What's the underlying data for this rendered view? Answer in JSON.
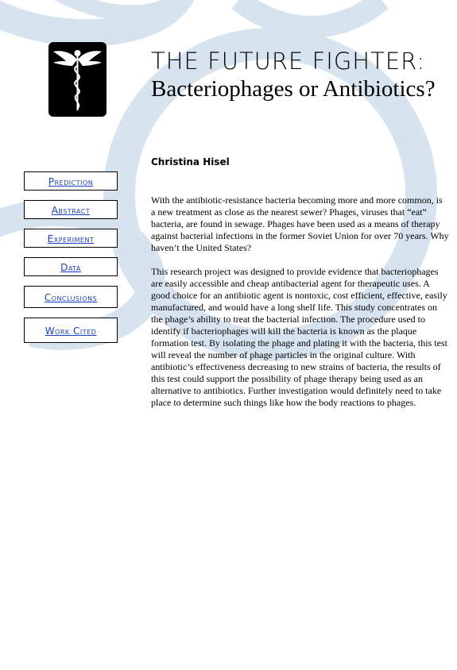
{
  "header": {
    "title_line1": "THE FUTURE FIGHTER:",
    "title_line2": "Bacteriophages or Antibiotics?",
    "logo_icon": "caduceus-icon"
  },
  "author": "Christina Hisel",
  "nav": {
    "items": [
      {
        "label": "Prediction"
      },
      {
        "label": "Abstract"
      },
      {
        "label": "Experiment"
      },
      {
        "label": "Data"
      },
      {
        "label": "Conclusions"
      },
      {
        "label": "Work Cited"
      }
    ]
  },
  "body": {
    "paragraph1": "With the antibiotic-resistance bacteria becoming more and more common, is a new treatment as close as the nearest sewer? Phages, viruses that “eat” bacteria, are found in sewage. Phages have been used as a means of therapy against bacterial infections in the former Soviet Union for over 70 years. Why haven’t the United States?",
    "paragraph2": "This research project was designed to provide evidence that bacteriophages are easily accessible and cheap antibacterial agent for therapeutic uses. A good choice for an antibiotic agent is nontoxic, cost efficient, effective, easily manufactured, and would have a long shelf life. This study concentrates on the phage’s ability to treat the bacterial infection. The procedure used to identify if bacteriophages will kill the bacteria is known as the plaque formation test. By isolating the phage and plating it with the bacteria, this test will reveal the number of phage particles in the original culture. With antibiotic’s effectiveness decreasing to new strains of bacteria, the results of this test could support the possibility of phage therapy being used as an alternative to antibiotics. Further investigation would definitely need to take place to determine such things like how the body reactions to phages."
  },
  "colors": {
    "background_swirl": "#d7e4ef",
    "link": "#1a3fc7",
    "logo_bg": "#000000"
  }
}
